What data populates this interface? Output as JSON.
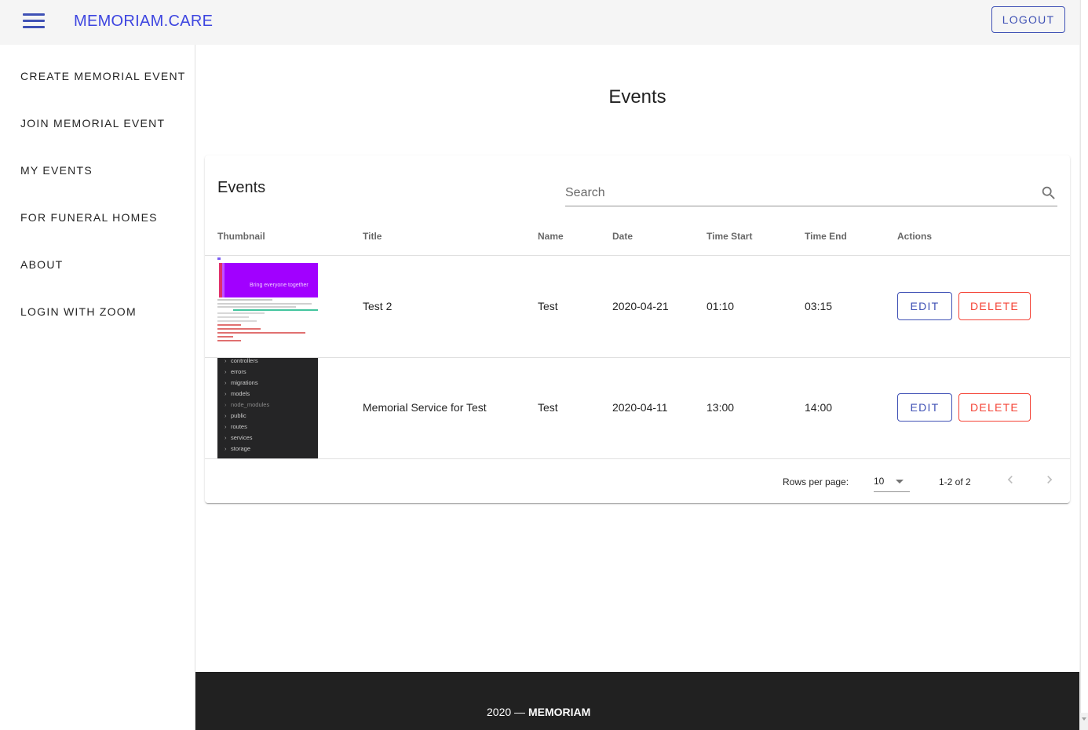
{
  "app": {
    "brand": "MEMORIAM.CARE",
    "logout_label": "LOGOUT",
    "accent": "#3f51b5",
    "danger": "#f44336"
  },
  "sidebar": {
    "items": [
      {
        "label": "CREATE MEMORIAL EVENT"
      },
      {
        "label": "JOIN MEMORIAL EVENT"
      },
      {
        "label": "MY EVENTS"
      },
      {
        "label": "FOR FUNERAL HOMES"
      },
      {
        "label": "ABOUT"
      },
      {
        "label": "LOGIN WITH ZOOM"
      }
    ]
  },
  "page": {
    "title": "Events"
  },
  "table": {
    "title": "Events",
    "search_placeholder": "Search",
    "columns": [
      "Thumbnail",
      "Title",
      "Name",
      "Date",
      "Time Start",
      "Time End",
      "Actions"
    ],
    "rows": [
      {
        "thumbnail": "screenshot-thumbnail",
        "thumb_text": "Bring everyone together",
        "title": "Test 2",
        "name": "Test",
        "date": "2020-04-21",
        "time_start": "01:10",
        "time_end": "03:15",
        "edit_label": "EDIT",
        "delete_label": "DELETE"
      },
      {
        "thumbnail": "file-tree-thumbnail",
        "thumb_items": [
          "controllers",
          "errors",
          "migrations",
          "models",
          "node_modules",
          "public",
          "routes",
          "services",
          "storage"
        ],
        "title": "Memorial Service for Test",
        "name": "Test",
        "date": "2020-04-11",
        "time_start": "13:00",
        "time_end": "14:00",
        "edit_label": "EDIT",
        "delete_label": "DELETE"
      }
    ],
    "pagination": {
      "rows_per_page_label": "Rows per page:",
      "rows_per_page": "10",
      "range": "1-2 of 2"
    }
  },
  "footer": {
    "year": "2020 —",
    "brand": "MEMORIAM"
  }
}
